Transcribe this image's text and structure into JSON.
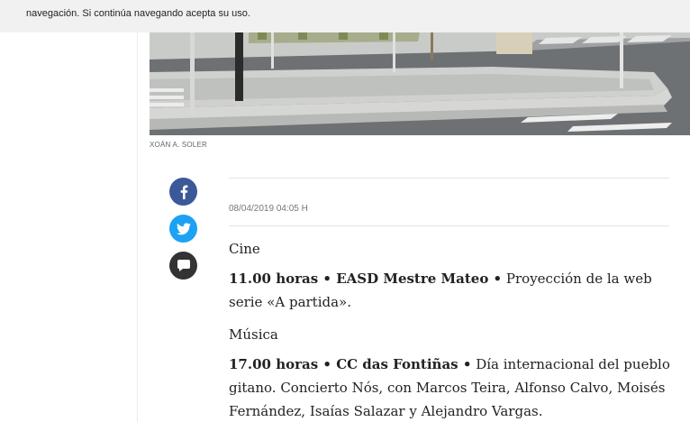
{
  "cookie_notice": {
    "text": "navegación. Si continúa navegando acepta su uso."
  },
  "photo": {
    "credit": "XOÁN A. SOLER"
  },
  "share": {
    "facebook_icon": "facebook-icon",
    "twitter_icon": "twitter-icon",
    "comment_icon": "comment-icon",
    "colors": {
      "facebook": "#3b5998",
      "twitter": "#1da1f2",
      "comment": "#333333"
    }
  },
  "article": {
    "date": "08/04/2019 04:05 H",
    "blocks": [
      {
        "section": "Cine"
      },
      {
        "lead": "11.00 horas • EASD Mestre Mateo •",
        "text": " Proyección de la web serie «A partida»."
      },
      {
        "section": "Música"
      },
      {
        "lead": "17.00 horas • CC das Fontiñas •",
        "text": " Día internacional del pueblo gitano. Concierto Nós, con Marcos Teira, Alfonso Calvo, Moisés Fernández, Isaías Salazar y Alejandro Vargas."
      }
    ]
  }
}
